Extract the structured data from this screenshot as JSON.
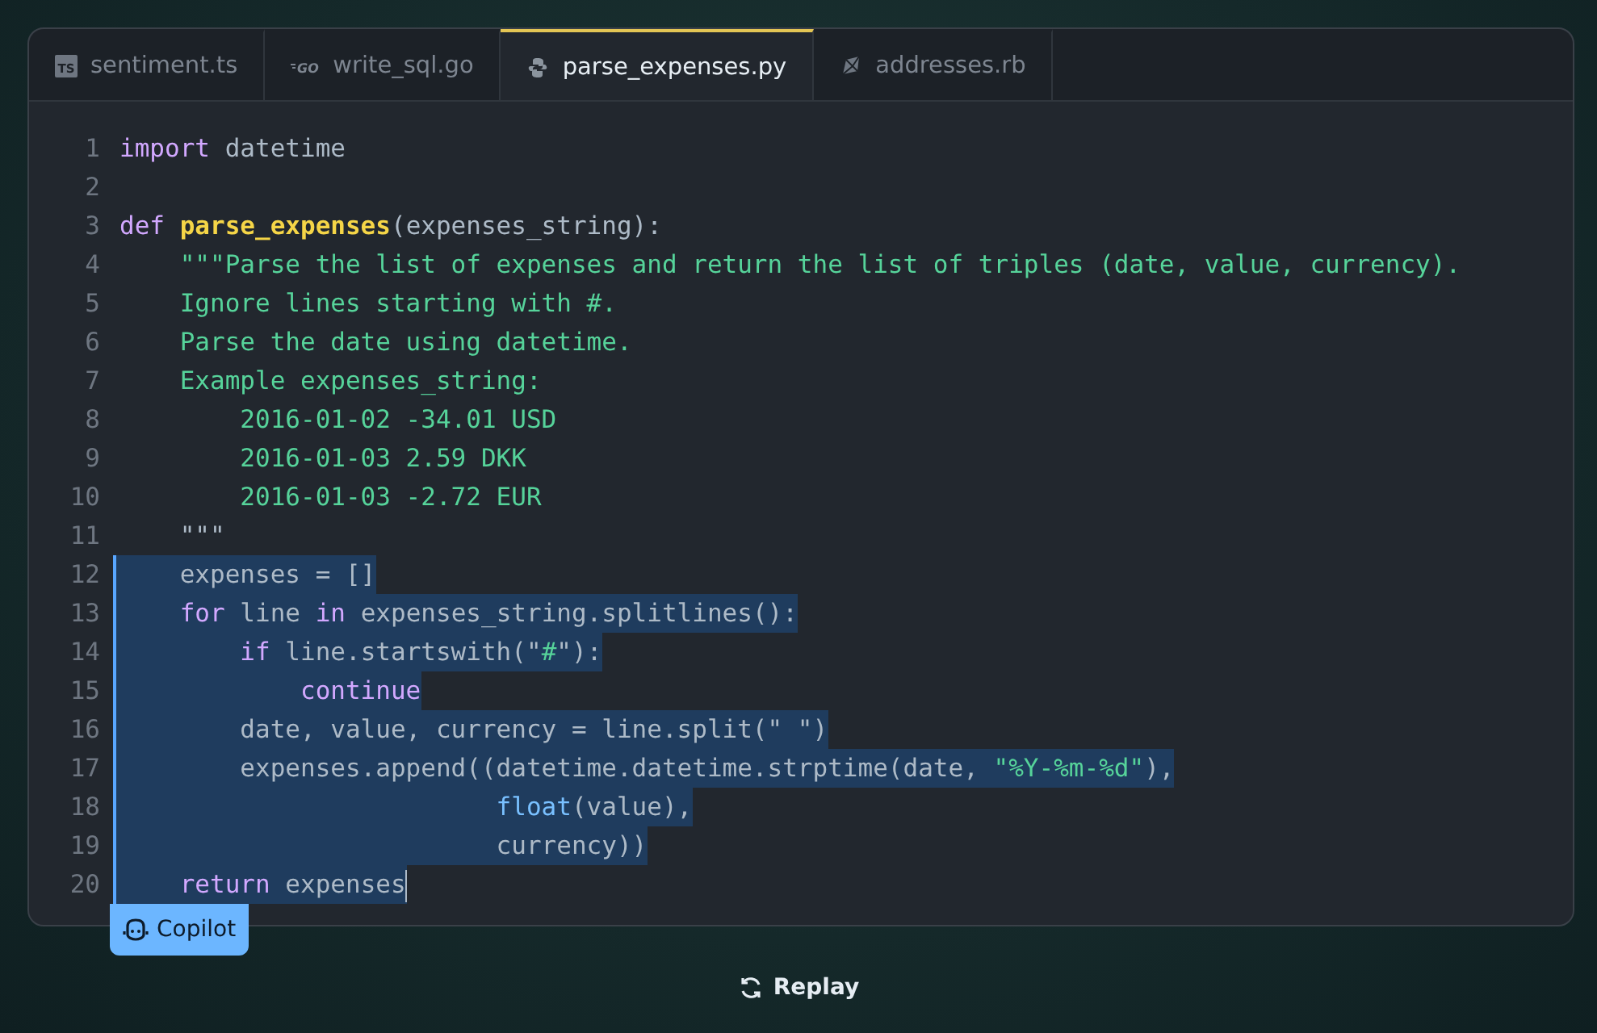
{
  "tabs": [
    {
      "label": "sentiment.ts",
      "kind": "ts",
      "icon_text": "TS",
      "selected": false
    },
    {
      "label": "write_sql.go",
      "kind": "go",
      "icon_text": "GO",
      "selected": false
    },
    {
      "label": "parse_expenses.py",
      "kind": "py",
      "selected": true
    },
    {
      "label": "addresses.rb",
      "kind": "rb",
      "selected": false
    }
  ],
  "code": {
    "lines": [
      {
        "number": "1",
        "selected": false,
        "tokens": [
          {
            "text": "import",
            "kind": "keyword"
          },
          {
            "text": " datetime",
            "kind": "plain"
          }
        ]
      },
      {
        "number": "2",
        "selected": false
      },
      {
        "number": "3",
        "selected": false,
        "tokens": [
          {
            "text": "def ",
            "kind": "keyword"
          },
          {
            "text": "parse_expenses",
            "kind": "function"
          },
          {
            "text": "(expenses_string):",
            "kind": "plain"
          }
        ]
      },
      {
        "number": "4",
        "selected": false,
        "tokens": [
          {
            "text": "    \"\"\"Parse the list of expenses and return the list of triples (date, value, currency).",
            "kind": "string"
          }
        ]
      },
      {
        "number": "5",
        "selected": false,
        "tokens": [
          {
            "text": "    Ignore lines starting with #.",
            "kind": "string"
          }
        ]
      },
      {
        "number": "6",
        "selected": false,
        "tokens": [
          {
            "text": "    Parse the date using datetime.",
            "kind": "string"
          }
        ]
      },
      {
        "number": "7",
        "selected": false,
        "tokens": [
          {
            "text": "    Example expenses_string:",
            "kind": "string"
          }
        ]
      },
      {
        "number": "8",
        "selected": false,
        "tokens": [
          {
            "text": "        2016-01-02 -34.01 USD",
            "kind": "string"
          }
        ]
      },
      {
        "number": "9",
        "selected": false,
        "tokens": [
          {
            "text": "        2016-01-03 2.59 DKK",
            "kind": "string"
          }
        ]
      },
      {
        "number": "10",
        "selected": false,
        "tokens": [
          {
            "text": "        2016-01-03 -2.72 EUR",
            "kind": "string"
          }
        ]
      },
      {
        "number": "11",
        "selected": false,
        "tokens": [
          {
            "text": "    \"\"\"",
            "kind": "plain"
          }
        ]
      },
      {
        "number": "12",
        "selected": true,
        "tokens": [
          {
            "text": "    expenses = []",
            "kind": "plain"
          }
        ]
      },
      {
        "number": "13",
        "selected": true,
        "tokens": [
          {
            "text": "    for",
            "kind": "keyword"
          },
          {
            "text": " line ",
            "kind": "plain"
          },
          {
            "text": "in",
            "kind": "keyword"
          },
          {
            "text": " expenses_string.splitlines():",
            "kind": "plain"
          }
        ]
      },
      {
        "number": "14",
        "selected": true,
        "tokens": [
          {
            "text": "        if",
            "kind": "keyword"
          },
          {
            "text": " line.startswith(\"",
            "kind": "plain"
          },
          {
            "text": "#",
            "kind": "string"
          },
          {
            "text": "\"):",
            "kind": "plain"
          }
        ]
      },
      {
        "number": "15",
        "selected": true,
        "tokens": [
          {
            "text": "            continue",
            "kind": "keyword"
          }
        ]
      },
      {
        "number": "16",
        "selected": true,
        "tokens": [
          {
            "text": "        date, value, currency = line.split(\" \")",
            "kind": "plain"
          }
        ]
      },
      {
        "number": "17",
        "selected": true,
        "tokens": [
          {
            "text": "        expenses.append((datetime.datetime.strptime(date, ",
            "kind": "plain"
          },
          {
            "text": "\"%Y-%m-%d\"",
            "kind": "string"
          },
          {
            "text": "),",
            "kind": "plain"
          }
        ]
      },
      {
        "number": "18",
        "selected": true,
        "tokens": [
          {
            "text": "                         float",
            "kind": "builtin"
          },
          {
            "text": "(value),",
            "kind": "plain"
          }
        ]
      },
      {
        "number": "19",
        "selected": true,
        "tokens": [
          {
            "text": "                         currency))",
            "kind": "plain"
          }
        ]
      },
      {
        "number": "20",
        "selected": true,
        "tokens": [
          {
            "text": "    return",
            "kind": "keyword"
          },
          {
            "text": " expenses",
            "kind": "plain"
          }
        ]
      }
    ]
  },
  "copilot_badge": {
    "label": "Copilot"
  },
  "replay_button": {
    "label": "Replay"
  }
}
